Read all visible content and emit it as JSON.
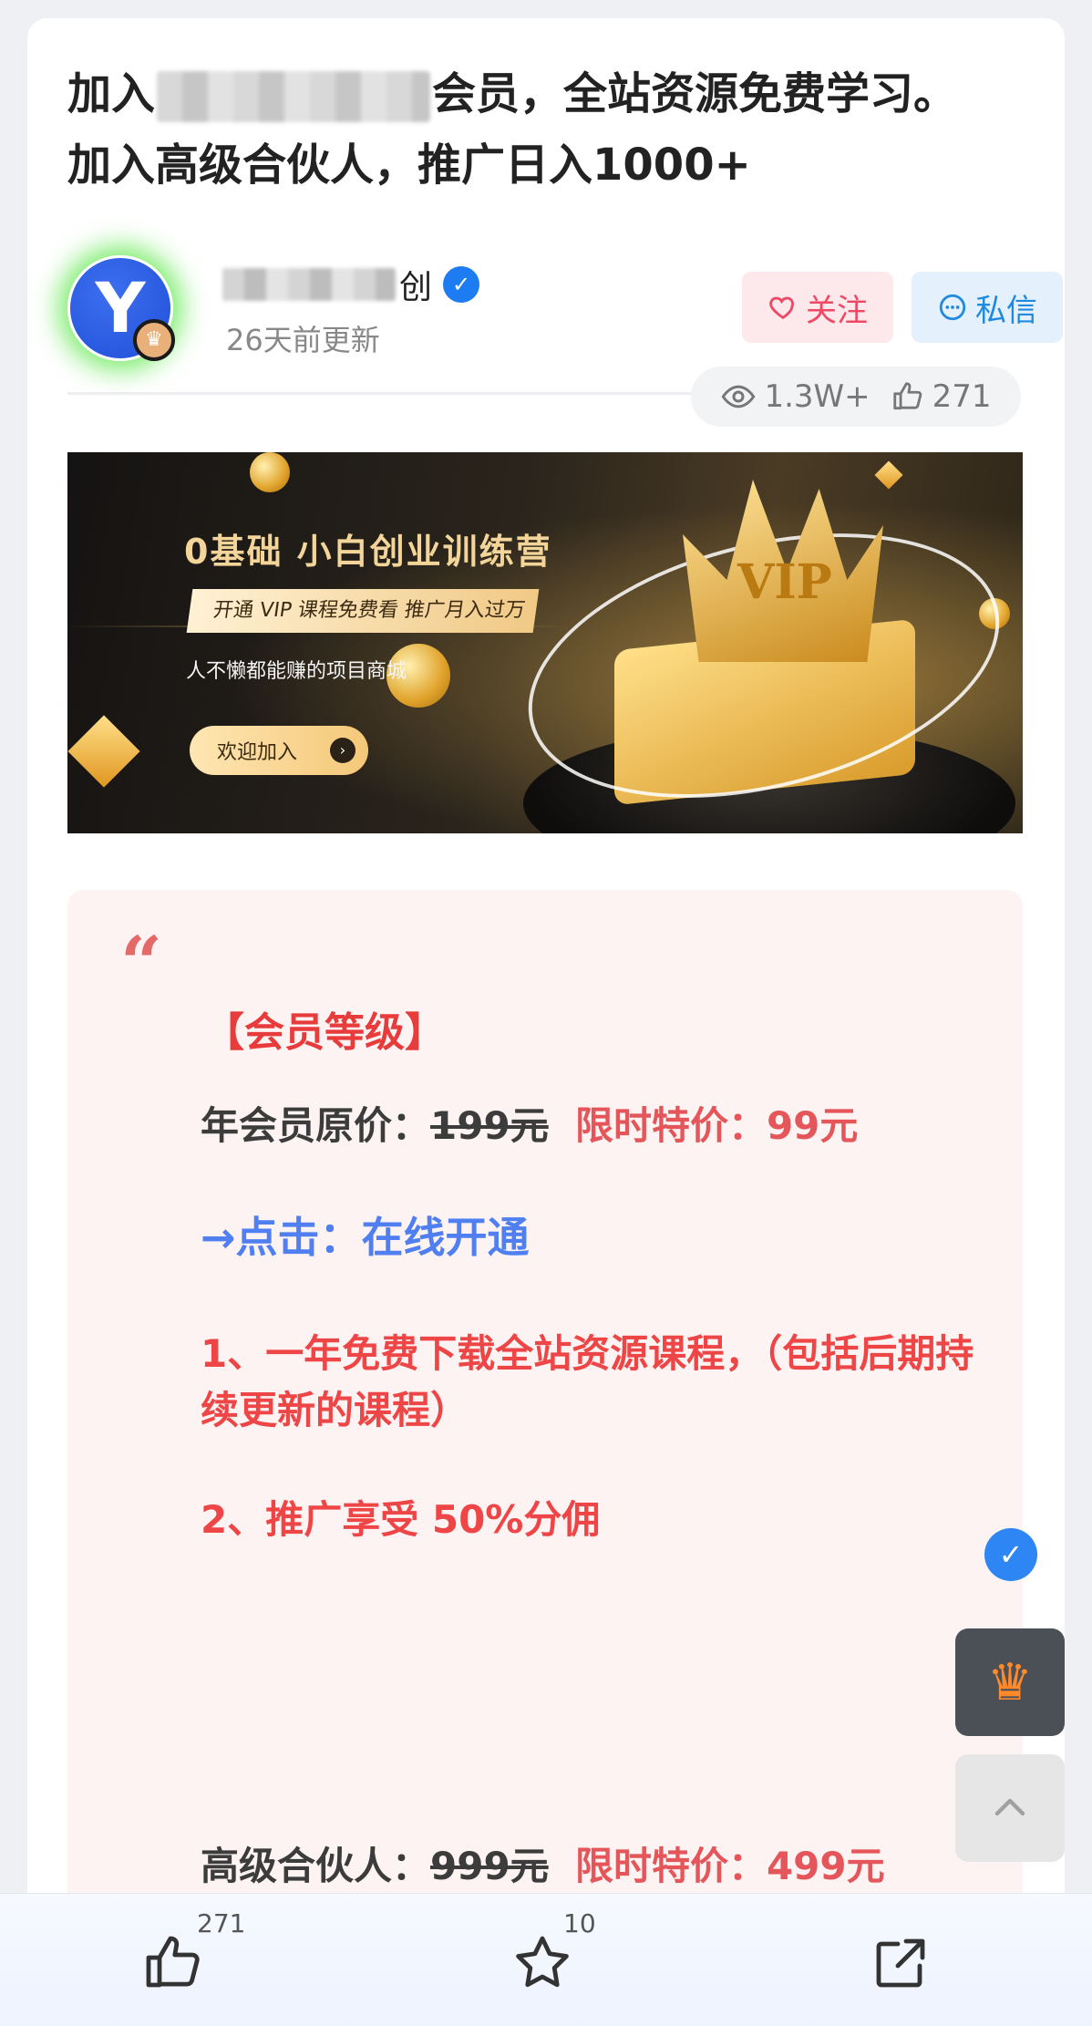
{
  "article": {
    "title_prefix": "加入",
    "title_line1_suffix": "会员，全站资源免费学习。",
    "title_line2": "加入高级合伙人，推广日入1000+"
  },
  "author": {
    "avatar_letter": "Y",
    "name_visible_suffix": "创",
    "updated": "26天前更新",
    "follow_label": "关注",
    "message_label": "私信"
  },
  "stats": {
    "views": "1.3W+",
    "likes": "271"
  },
  "banner": {
    "title": "0基础 小白创业训练营",
    "subtitle": "开通 VIP 课程免费看 推广月入过万",
    "description": "人不懒都能赚的项目商城",
    "button_label": "欢迎加入",
    "crown_text": "VIP"
  },
  "content": {
    "heading": "【会员等级】",
    "annual_label": "年会员原价：",
    "annual_original": "199元",
    "annual_special": "限时特价：99元",
    "open_link": "→点击：在线开通",
    "benefit1": "1、一年免费下载全站资源课程，（包括后期持续更新的课程）",
    "benefit2": "2、推广享受 50%分佣",
    "partner_label": "高级合伙人：",
    "partner_original": "999元",
    "partner_special": "限时特价：499元"
  },
  "bottom_bar": {
    "like_count": "271",
    "favorite_count": "10"
  },
  "icons": {
    "like": "thumbs-up-icon",
    "favorite": "star-icon",
    "share": "share-icon",
    "views": "eye-icon",
    "vip": "crown-icon",
    "top": "chevron-up-icon",
    "verified": "check-badge-icon"
  },
  "colors": {
    "follow": "#f04864",
    "message": "#1f8ae0",
    "highlight_red": "#ee4646",
    "link_blue": "#4f7ff0"
  }
}
